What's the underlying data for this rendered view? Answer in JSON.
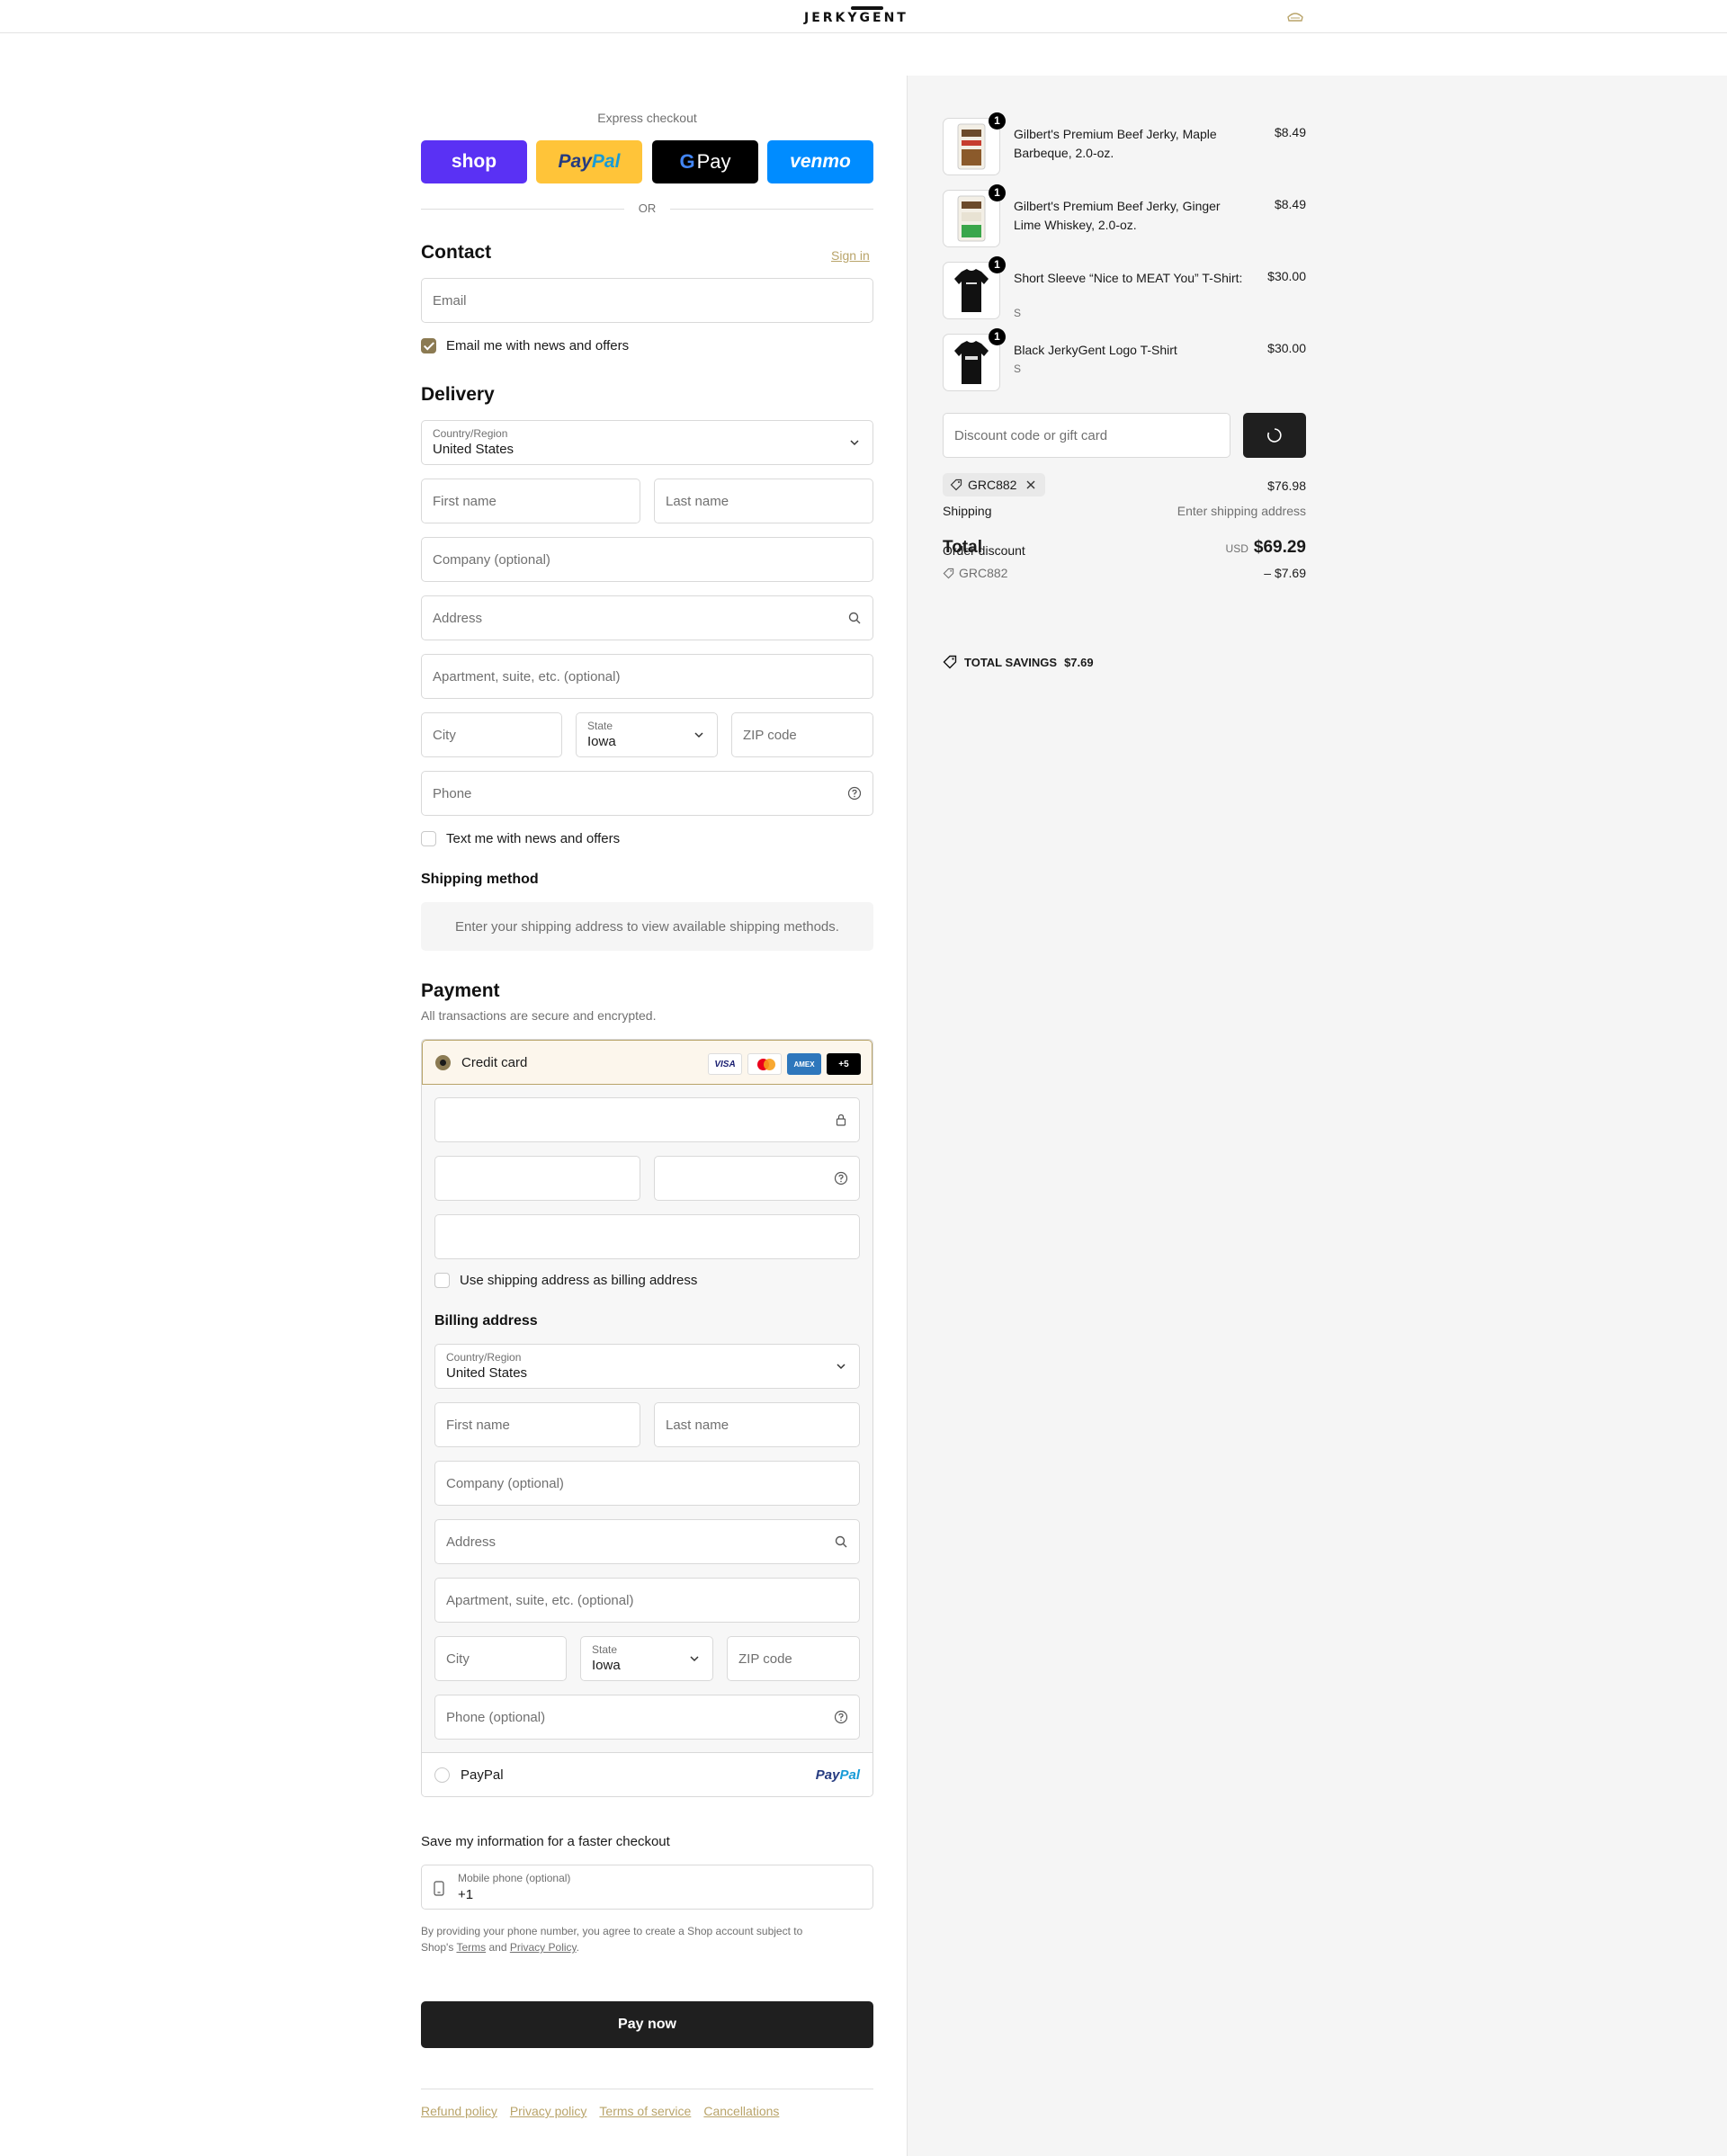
{
  "header": {
    "logo": "JERKYGENT",
    "cart_icon": "cart-icon"
  },
  "express": {
    "title": "Express checkout",
    "buttons": {
      "shop": "shop",
      "paypal_a": "Pay",
      "paypal_b": "Pal",
      "gpay_g": "G",
      "gpay": "Pay",
      "venmo": "venmo"
    },
    "or": "OR"
  },
  "contact": {
    "title": "Contact",
    "sign_in": "Sign in",
    "email_placeholder": "Email",
    "news_label": "Email me with news and offers",
    "news_checked": true
  },
  "delivery": {
    "title": "Delivery",
    "country_label": "Country/Region",
    "country_value": "United States",
    "first_name": "First name",
    "last_name": "Last name",
    "company": "Company (optional)",
    "address": "Address",
    "apartment": "Apartment, suite, etc. (optional)",
    "city": "City",
    "state_label": "State",
    "state_value": "Iowa",
    "zip": "ZIP code",
    "phone": "Phone",
    "text_label": "Text me with news and offers"
  },
  "shipping_method": {
    "title": "Shipping method",
    "note": "Enter your shipping address to view available shipping methods."
  },
  "payment": {
    "title": "Payment",
    "subtitle": "All transactions are secure and encrypted.",
    "credit_card": "Credit card",
    "card_logos": {
      "visa": "VISA",
      "amex": "AMEX",
      "more": "+5"
    },
    "use_shipping": "Use shipping address as billing address",
    "billing_title": "Billing address",
    "billing": {
      "country_label": "Country/Region",
      "country_value": "United States",
      "first_name": "First name",
      "last_name": "Last name",
      "company": "Company (optional)",
      "address": "Address",
      "apartment": "Apartment, suite, etc. (optional)",
      "city": "City",
      "state_label": "State",
      "state_value": "Iowa",
      "zip": "ZIP code",
      "phone": "Phone (optional)"
    },
    "paypal": "PayPal",
    "paypal_logo_a": "Pay",
    "paypal_logo_b": "Pal"
  },
  "save_info": {
    "title": "Save my information for a faster checkout",
    "mobile_label": "Mobile phone (optional)",
    "mobile_value": "+1",
    "legal_a": "By providing your phone number, you agree to create a Shop account subject to",
    "legal_b": "Shop's",
    "terms": "Terms",
    "and": "and",
    "privacy": "Privacy Policy",
    "period": "."
  },
  "pay_now": "Pay now",
  "footer": [
    "Refund policy",
    "Privacy policy",
    "Terms of service",
    "Cancellations"
  ],
  "summary": {
    "items": [
      {
        "qty": "1",
        "name": "Gilbert's Premium Beef Jerky, Maple Barbeque, 2.0-oz.",
        "variant": "",
        "price": "$8.49"
      },
      {
        "qty": "1",
        "name": "Gilbert's Premium Beef Jerky, Ginger Lime Whiskey, 2.0-oz.",
        "variant": "",
        "price": "$8.49"
      },
      {
        "qty": "1",
        "name": "Short Sleeve “Nice to MEAT You” T-Shirt:",
        "variant": "S",
        "price": "$30.00"
      },
      {
        "qty": "1",
        "name": "Black JerkyGent Logo T-Shirt",
        "variant": "S",
        "price": "$30.00"
      }
    ],
    "discount_placeholder": "Discount code or gift card",
    "applied_code": "GRC882",
    "subtotal": "$76.98",
    "shipping_label": "Shipping",
    "shipping_value": "Enter shipping address",
    "order_discount_label": "Order discount",
    "order_discount_code": "GRC882",
    "order_discount_value": "– $7.69",
    "total_label": "Total",
    "currency": "USD",
    "total_value": "$69.29",
    "savings_label": "TOTAL SAVINGS",
    "savings_value": "$7.69"
  },
  "colors": {
    "accent": "#b9a46a",
    "checkbox": "#8b7a52",
    "button": "#1f1f1f",
    "shop": "#5a31f4",
    "paypal": "#ffc439",
    "venmo": "#008cff"
  }
}
